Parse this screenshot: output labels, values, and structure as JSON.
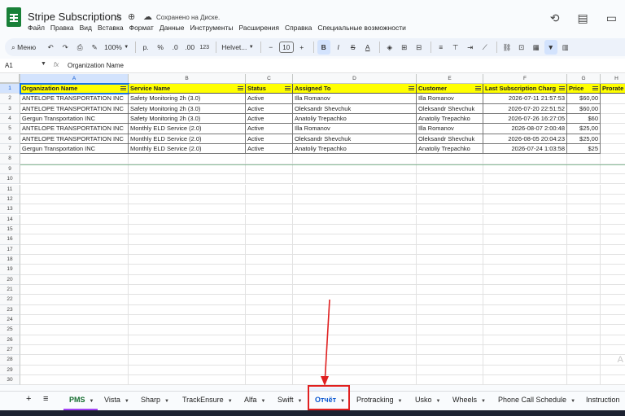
{
  "app": {
    "title": "Stripe Subscriptions",
    "saved_status": "Сохранено на Диске.",
    "menu": [
      "Файл",
      "Правка",
      "Вид",
      "Вставка",
      "Формат",
      "Данные",
      "Инструменты",
      "Расширения",
      "Справка",
      "Специальные возможности"
    ]
  },
  "toolbar": {
    "menu_search": "Меню",
    "zoom": "100%",
    "currency": "р.",
    "percent": "%",
    "decimal_dec": ".0",
    "decimal_inc": ".00",
    "format_123": "123",
    "font": "Helvet...",
    "font_size": "10",
    "bold": "B",
    "italic": "I",
    "strike": "S",
    "text_color": "A"
  },
  "formula_bar": {
    "name_box": "A1",
    "fx": "fx",
    "value": "Organization Name"
  },
  "grid": {
    "columns": [
      "A",
      "B",
      "C",
      "D",
      "E",
      "F",
      "G",
      "H"
    ],
    "row_numbers": [
      "1",
      "2",
      "3",
      "4",
      "5",
      "6",
      "7",
      "8",
      "9",
      "10",
      "11",
      "12",
      "13",
      "14",
      "15",
      "16",
      "17",
      "18",
      "19",
      "20",
      "21",
      "22",
      "23",
      "24",
      "25",
      "26",
      "27",
      "28",
      "29",
      "30"
    ],
    "headers": [
      "Organization Name",
      "Service Name",
      "Status",
      "Assigned To",
      "Customer",
      "Last Subscription Charg",
      "Price",
      "Prorate"
    ],
    "rows": [
      [
        "ANTELOPE TRANSPORTATION INC",
        "Safety Monitoring 2h (3.0)",
        "Active",
        "Illa Romanov",
        "Illa Romanov",
        "2026-07-11 21:57:53",
        "$60,00",
        ""
      ],
      [
        "ANTELOPE TRANSPORTATION INC",
        "Safety Monitoring 2h (3.0)",
        "Active",
        "Oleksandr Shevchuk",
        "Oleksandr Shevchuk",
        "2026-07-20 22:51:52",
        "$60,00",
        ""
      ],
      [
        "Gergun Transportation INC",
        "Safety Monitoring 2h (3.0)",
        "Active",
        "Anatoliy Trepachko",
        "Anatoliy Trepachko",
        "2026-07-26 16:27:05",
        "$60",
        ""
      ],
      [
        "ANTELOPE TRANSPORTATION INC",
        "Monthly ELD Service (2.0)",
        "Active",
        "Illa Romanov",
        "Illa Romanov",
        "2026-08-07 2:00:48",
        "$25,00",
        ""
      ],
      [
        "ANTELOPE TRANSPORTATION INC",
        "Monthly ELD Service (2.0)",
        "Active",
        "Oleksandr Shevchuk",
        "Oleksandr Shevchuk",
        "2026-08-05 20:04:23",
        "$25,00",
        ""
      ],
      [
        "Gergun Transportation INC",
        "Monthly ELD Service (2.0)",
        "Active",
        "Anatoliy Trepachko",
        "Anatoliy Trepachko",
        "2026-07-24 1:03:58",
        "$25",
        ""
      ]
    ]
  },
  "sheets": {
    "add": "+",
    "all": "≡",
    "tabs": [
      "PMS",
      "Vista",
      "Sharp",
      "TrackEnsure",
      "Alfa",
      "Swift",
      "Отчёт",
      "Protracking",
      "Usko",
      "Wheels",
      "Phone Call Schedule",
      "Instruction"
    ],
    "active_tab": "Отчёт"
  },
  "colors": {
    "header_fill": "#ffff00",
    "highlight": "#e02020",
    "accent": "#0b57d0"
  }
}
